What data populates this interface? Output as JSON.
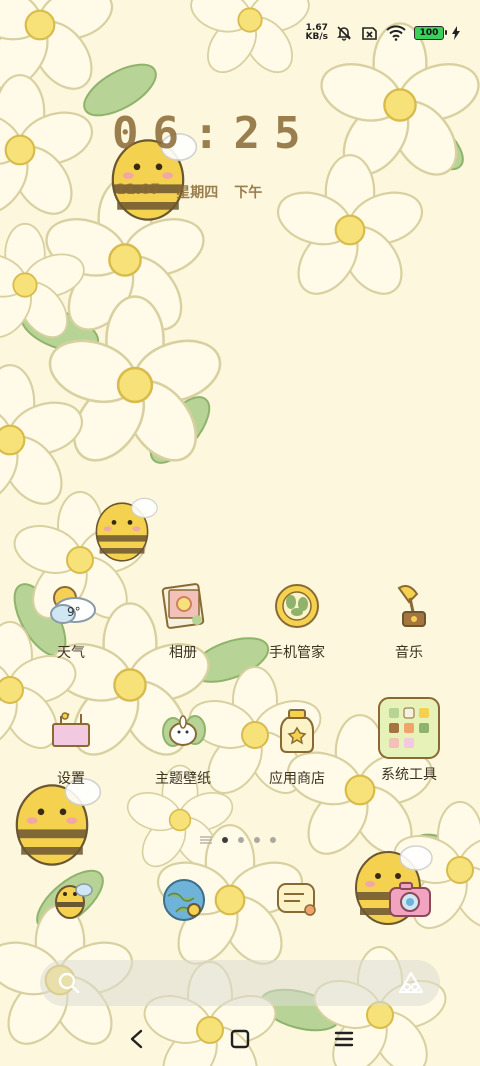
{
  "status_bar": {
    "net_speed_value": "1.67",
    "net_speed_unit": "KB/s",
    "battery_level": "100",
    "icons": [
      "bell-mute-icon",
      "sim-x-icon",
      "wifi-icon",
      "battery-icon",
      "charging-icon"
    ]
  },
  "clock": {
    "time": "06:25",
    "date": "11.07",
    "weekday": "星期四",
    "period": "下午"
  },
  "apps": [
    {
      "label": "天气",
      "icon": "weather-icon"
    },
    {
      "label": "相册",
      "icon": "gallery-icon"
    },
    {
      "label": "手机管家",
      "icon": "security-icon"
    },
    {
      "label": "音乐",
      "icon": "music-icon"
    },
    {
      "label": "设置",
      "icon": "settings-icon"
    },
    {
      "label": "主题壁纸",
      "icon": "themes-icon"
    },
    {
      "label": "应用商店",
      "icon": "app-store-icon"
    },
    {
      "label": "系统工具",
      "icon": "folder-icon"
    }
  ],
  "weather_temp": "9°",
  "page_indicator": {
    "pages": 4,
    "current": 1
  },
  "dock": [
    "phone-icon",
    "browser-icon",
    "messages-icon",
    "camera-icon"
  ],
  "colors": {
    "accent": "#f5c842",
    "leaf": "#9bc27a",
    "petal": "#fffbe8"
  }
}
